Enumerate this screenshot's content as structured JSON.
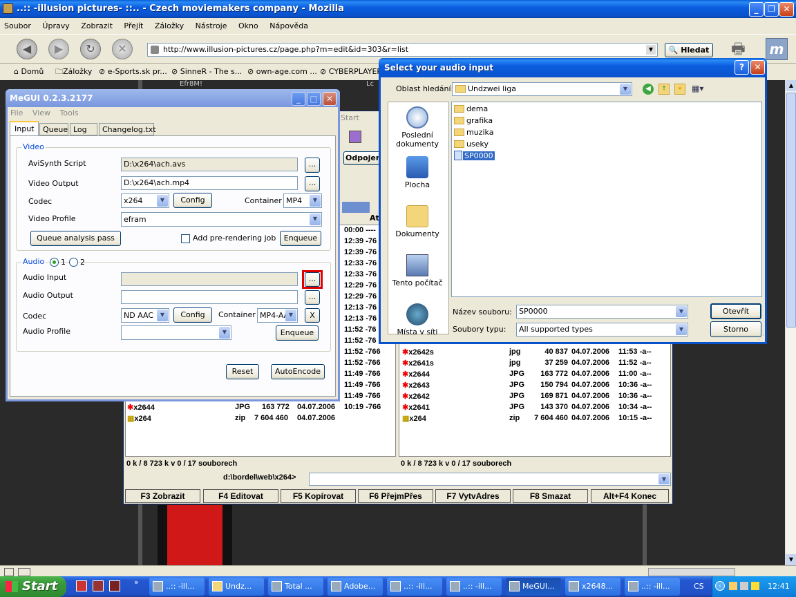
{
  "browser": {
    "title": "..:: -illusion pictures- ::.. - Czech moviemakers company - Mozilla",
    "menu": [
      "Soubor",
      "Úpravy",
      "Zobrazit",
      "Přejít",
      "Záložky",
      "Nástroje",
      "Okno",
      "Nápověda"
    ],
    "url": "http://www.illusion-pictures.cz/page.php?m=edit&id=303&r=list",
    "search_label": "Hledat",
    "bookmarks": [
      "Domů",
      "Záložky",
      "e-Sports.sk pr...",
      "SinneR - The s...",
      "own-age.com ...",
      "CYBERPLAYER..."
    ],
    "page_text_top": "Efr8M!",
    "page_text_right": "Lc"
  },
  "megui": {
    "title": "MeGUI 0.2.3.2177",
    "menu": [
      "File",
      "View",
      "Tools"
    ],
    "tabs": [
      "Input",
      "Queue",
      "Log",
      "Changelog.txt"
    ],
    "video": {
      "group": "Video",
      "avisynth_label": "AviSynth Script",
      "avisynth_value": "D:\\x264\\ach.avs",
      "output_label": "Video Output",
      "output_value": "D:\\x264\\ach.mp4",
      "codec_label": "Codec",
      "codec_value": "x264",
      "config": "Config",
      "container_label": "Container",
      "container_value": "MP4",
      "profile_label": "Video Profile",
      "profile_value": "efram",
      "queue_analysis": "Queue analysis pass",
      "add_prerender": "Add pre-rendering job",
      "enqueue": "Enqueue",
      "browse": "..."
    },
    "audio": {
      "group": "Audio",
      "radio1": "1",
      "radio2": "2",
      "input_label": "Audio Input",
      "input_value": "",
      "output_label": "Audio Output",
      "output_value": "",
      "codec_label": "Codec",
      "codec_value": "ND AAC",
      "config": "Config",
      "container_label": "Container",
      "container_value": "MP4-AAC",
      "clear": "X",
      "profile_label": "Audio Profile",
      "profile_value": "",
      "enqueue": "Enqueue",
      "browse": "..."
    },
    "reset": "Reset",
    "autoencode": "AutoEncode"
  },
  "tc": {
    "partial_tab": "Start",
    "odpojeni": "Odpojeni",
    "atr_header": "Atr",
    "times": [
      "00:00 ----",
      "12:39 -76",
      "12:39 -76",
      "12:33 -76",
      "12:33 -76",
      "12:29 -76",
      "12:29 -76",
      "12:13 -76",
      "12:13 -76",
      "11:52 -76",
      "11:52 -76",
      "11:52 -766",
      "11:52 -766",
      "11:49 -766",
      "11:49 -766",
      "11:49 -766",
      "10:19 -766"
    ],
    "left_rows": [
      {
        "name": "x2644",
        "ext": "JPG",
        "size": "163 772",
        "date": "04.07.2006"
      },
      {
        "name": "x264",
        "ext": "zip",
        "size": "7 604 460",
        "date": "04.07.2006"
      }
    ],
    "right_rows": [
      {
        "name": "x2642s",
        "ext": "jpg",
        "size": "40 837",
        "date": "04.07.2006",
        "time": "11:53 -a--"
      },
      {
        "name": "x2641s",
        "ext": "jpg",
        "size": "37 259",
        "date": "04.07.2006",
        "time": "11:52 -a--"
      },
      {
        "name": "x2644",
        "ext": "JPG",
        "size": "163 772",
        "date": "04.07.2006",
        "time": "11:00 -a--"
      },
      {
        "name": "x2643",
        "ext": "JPG",
        "size": "150 794",
        "date": "04.07.2006",
        "time": "10:36 -a--"
      },
      {
        "name": "x2642",
        "ext": "JPG",
        "size": "169 871",
        "date": "04.07.2006",
        "time": "10:36 -a--"
      },
      {
        "name": "x2641",
        "ext": "JPG",
        "size": "143 370",
        "date": "04.07.2006",
        "time": "10:34 -a--"
      },
      {
        "name": "x264",
        "ext": "zip",
        "size": "7 604 460",
        "date": "04.07.2006",
        "time": "10:15 -a--"
      }
    ],
    "status_left": "0 k / 8 723 k v 0 / 17 souborech",
    "status_right": "0 k / 8 723 k v 0 / 17 souborech",
    "path": "d:\\bordel\\web\\x264>",
    "fkeys": [
      "F3 Zobrazit",
      "F4 Editovat",
      "F5 Kopírovat",
      "F6 PřejmPřes",
      "F7 VytvAdres",
      "F8 Smazat",
      "Alt+F4 Konec"
    ]
  },
  "dialog": {
    "title": "Select your audio input",
    "lookin_label": "Oblast hledání:",
    "lookin_value": "Undzwei liga",
    "places": [
      "Poslední dokumenty",
      "Plocha",
      "Dokumenty",
      "Tento počítač",
      "Místa v síti"
    ],
    "files": [
      "dema",
      "grafika",
      "muzika",
      "useky",
      "SP0000"
    ],
    "filename_label": "Název souboru:",
    "filename_value": "SP0000",
    "filetype_label": "Soubory typu:",
    "filetype_value": "All supported types",
    "open": "Otevřít",
    "cancel": "Storno"
  },
  "taskbar": {
    "start": "Start",
    "tasks": [
      "..:: -ill...",
      "Undz...",
      "Total ...",
      "Adobe...",
      "..:: -ill...",
      "..:: -ill...",
      "MeGUI...",
      "x2648...",
      "..:: -ill..."
    ],
    "lang": "CS",
    "clock": "12:41"
  },
  "colors": {
    "xp_blue": "#0a52cc",
    "taskbar": "#2457d0",
    "start_green": "#3c9a3c",
    "highlight": "#316ac5",
    "red_outline": "#e00000"
  }
}
